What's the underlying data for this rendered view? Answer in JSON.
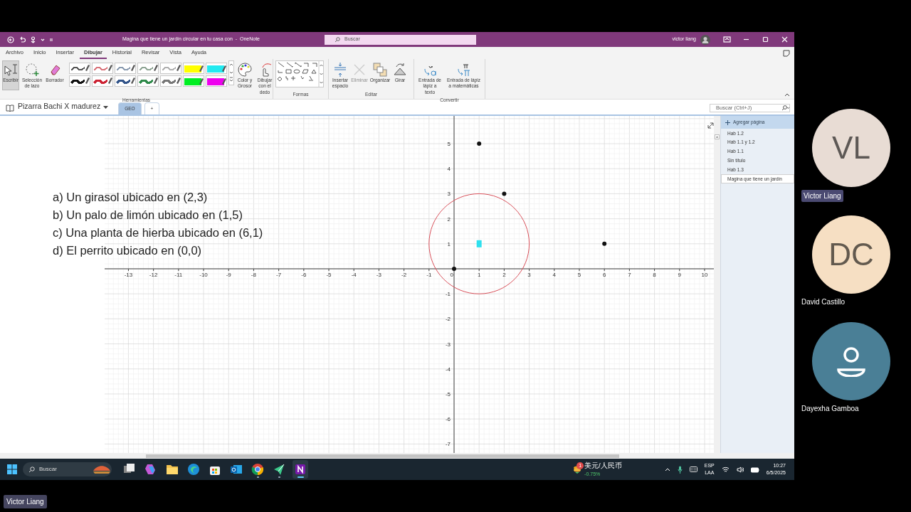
{
  "window": {
    "title": "Magina que tiene un jardín circular en tu casa con  -  OneNote",
    "search_placeholder": "Buscar",
    "user": "victor liang"
  },
  "ribbon_tabs": [
    {
      "label": "Archivo",
      "selected": false
    },
    {
      "label": "Inicio",
      "selected": false
    },
    {
      "label": "Insertar",
      "selected": false
    },
    {
      "label": "Dibujar",
      "selected": true
    },
    {
      "label": "Historial",
      "selected": false
    },
    {
      "label": "Revisar",
      "selected": false
    },
    {
      "label": "Vista",
      "selected": false
    },
    {
      "label": "Ayuda",
      "selected": false
    }
  ],
  "ribbon": {
    "tools": [
      {
        "label": "Escribir",
        "selected": true
      },
      {
        "label": "Selección de lazo",
        "selected": false
      },
      {
        "label": "Borrador",
        "selected": false
      }
    ],
    "pens": [
      {
        "kind": "pen",
        "color": "#555555"
      },
      {
        "kind": "pen",
        "color": "#d9737a"
      },
      {
        "kind": "pen",
        "color": "#8a9bb0"
      },
      {
        "kind": "pen",
        "color": "#8fa595"
      },
      {
        "kind": "pen",
        "color": "#b0b0b0"
      },
      {
        "kind": "highlighter",
        "color": "#ffff00"
      },
      {
        "kind": "highlighter",
        "color": "#22eaf0"
      },
      {
        "kind": "pen",
        "color": "#111111"
      },
      {
        "kind": "pen",
        "color": "#cc2233"
      },
      {
        "kind": "pen",
        "color": "#33558a"
      },
      {
        "kind": "pen",
        "color": "#2f8a4a"
      },
      {
        "kind": "pen",
        "color": "#777777"
      },
      {
        "kind": "highlighter",
        "color": "#00ee22"
      },
      {
        "kind": "highlighter",
        "color": "#ee00ee"
      }
    ],
    "pen_options": [
      "Color y Grosor",
      "Dibujar con el dedo"
    ],
    "edit_buttons": [
      {
        "label": "Insertar espacio",
        "disabled": false
      },
      {
        "label": "Eliminar",
        "disabled": true
      },
      {
        "label": "Organizar",
        "disabled": false
      },
      {
        "label": "Girar",
        "disabled": false
      }
    ],
    "convert_buttons": [
      "Entrada de lápiz a texto",
      "Entrada de lápiz a matemáticas"
    ],
    "group_labels": [
      "Herramientas",
      "Formas",
      "Editar",
      "Convertir"
    ]
  },
  "notebook": {
    "name": "Pizarra Bachi X madurez",
    "sections": [
      {
        "label": "GEO",
        "selected": true
      },
      {
        "label": "+",
        "selected": false
      }
    ],
    "search_placeholder": "Buscar (Ctrl+J)"
  },
  "page": {
    "problem_lines": [
      "a) Un girasol ubicado en (2,3)",
      "b) Un palo de limón ubicado en (1,5)",
      "c) Una planta de hierba ubicado en (6,1)",
      "d) El perrito ubicado en (0,0)"
    ],
    "graph": {
      "chart_data": {
        "type": "scatter",
        "grid": true,
        "xlim": [
          -13.95,
          10.37
        ],
        "ylim": [
          -7.36,
          6.11
        ],
        "xticks": [
          -13,
          -12,
          -11,
          -10,
          -9,
          -8,
          -7,
          -6,
          -5,
          -4,
          -3,
          -2,
          -1,
          0,
          1,
          2,
          3,
          4,
          5,
          6,
          7,
          8,
          9,
          10
        ],
        "yticks": [
          -7,
          -6,
          -5,
          -4,
          -3,
          -2,
          -1,
          1,
          2,
          3,
          4,
          5
        ],
        "x": [
          0,
          1,
          2,
          6,
          1
        ],
        "series": [
          {
            "color": "#111111",
            "values": [
              0,
              5,
              3,
              1,
              null
            ]
          },
          {
            "color": "#2ee0ee",
            "values": [
              null,
              null,
              null,
              null,
              1
            ]
          }
        ]
      }
    }
  },
  "pages": {
    "add_page": "Agregar página",
    "items": [
      {
        "title": "Hab 1.2",
        "selected": false
      },
      {
        "title": "Hab 1.1 y 1.2",
        "selected": false
      },
      {
        "title": "Hab 1.1",
        "selected": false
      },
      {
        "title": "Sin título",
        "selected": false
      },
      {
        "title": "Hab 1.3",
        "selected": false
      },
      {
        "title": "Magina que tiene un jardín",
        "selected": true
      }
    ]
  },
  "taskbar": {
    "search_placeholder": "Buscar",
    "apps": [
      {
        "active": false,
        "running": false
      },
      {
        "active": false,
        "running": false
      },
      {
        "active": false,
        "running": false
      },
      {
        "active": false,
        "running": false
      },
      {
        "active": false,
        "running": false
      },
      {
        "active": false,
        "running": false
      },
      {
        "active": false,
        "running": true
      },
      {
        "active": false,
        "running": true
      },
      {
        "active": true,
        "running": true
      }
    ],
    "widget": {
      "badge": "1",
      "title": "美元/人民币",
      "change": "-0.75%"
    },
    "language": [
      "ESP",
      "LAA"
    ],
    "time": "10:27",
    "date": "6/5/2025"
  },
  "participants": [
    {
      "kind": "initials",
      "initials": "VL",
      "name": "Victor Liang",
      "speaking": true,
      "color": "#e8dcd4"
    },
    {
      "kind": "initials",
      "initials": "DC",
      "name": "David Castillo",
      "speaking": false,
      "color": "#f6dfc3"
    },
    {
      "kind": "avatar",
      "name": "Dayexha Gamboa",
      "speaking": false,
      "color": "#4a7f96"
    }
  ],
  "self_label": "Victor Liang"
}
